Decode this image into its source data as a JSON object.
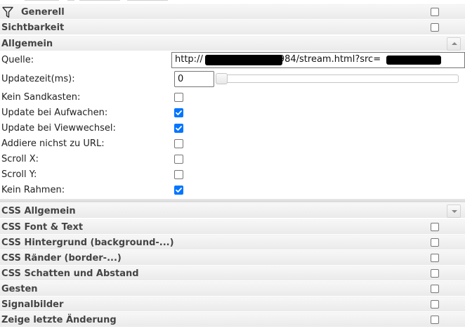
{
  "groups_top": [
    {
      "title": "Generell"
    },
    {
      "title": "Sichtbarkeit"
    },
    {
      "title": "Allgemein"
    }
  ],
  "allgemein": {
    "quelle": {
      "label": "Quelle:",
      "value_prefix": "http://",
      "value_mid": "984/stream.html?src="
    },
    "updatezeit": {
      "label": "Updatezeit(ms):",
      "value": "0",
      "slider_fraction": 0
    },
    "checks": [
      {
        "label": "Kein Sandkasten:",
        "checked": false
      },
      {
        "label": "Update bei Aufwachen:",
        "checked": true
      },
      {
        "label": "Update bei Viewwechsel:",
        "checked": true
      },
      {
        "label": "Addiere nichst zu URL:",
        "checked": false
      },
      {
        "label": "Scroll X:",
        "checked": false
      },
      {
        "label": "Scroll Y:",
        "checked": false
      },
      {
        "label": "Kein Rahmen:",
        "checked": true
      }
    ]
  },
  "groups_bottom": [
    {
      "title": "CSS Allgemein"
    },
    {
      "title": "CSS Font & Text"
    },
    {
      "title": "CSS Hintergrund (background-...)"
    },
    {
      "title": "CSS Ränder (border-...)"
    },
    {
      "title": "CSS Schatten und Abstand"
    },
    {
      "title": "Gesten"
    },
    {
      "title": "Signalbilder"
    },
    {
      "title": "Zeige letzte Änderung"
    }
  ],
  "icons": {
    "filter": "filter-icon",
    "collapse": "chevron-up-icon",
    "expand": "chevron-down-icon",
    "checkmark": "checkmark-icon"
  },
  "colors": {
    "checkbox_checked": "#0075ff",
    "header_bg": "#ececec"
  }
}
